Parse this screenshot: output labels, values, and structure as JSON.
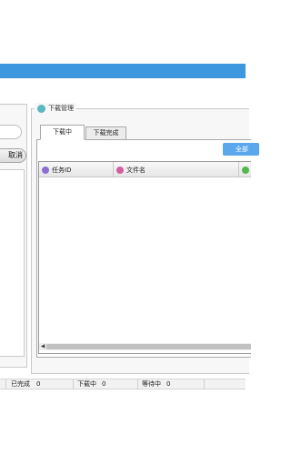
{
  "left_panel": {
    "cancel_label": "取消"
  },
  "download_manager": {
    "title": "下载管理",
    "tabs": [
      {
        "label": "下载中"
      },
      {
        "label": "下载完成"
      }
    ],
    "start_all_label": "全部",
    "table": {
      "columns": [
        {
          "label": "任务ID"
        },
        {
          "label": "文件名"
        },
        {
          "label": ""
        }
      ],
      "rows": []
    }
  },
  "status_bar": {
    "completed_label": "已完成",
    "completed_value": "0",
    "downloading_label": "下载中",
    "downloading_value": "0",
    "waiting_label": "等待中",
    "waiting_value": "0"
  },
  "colors": {
    "accent": "#3d98e0",
    "button_blue": "#5aa7ee"
  }
}
